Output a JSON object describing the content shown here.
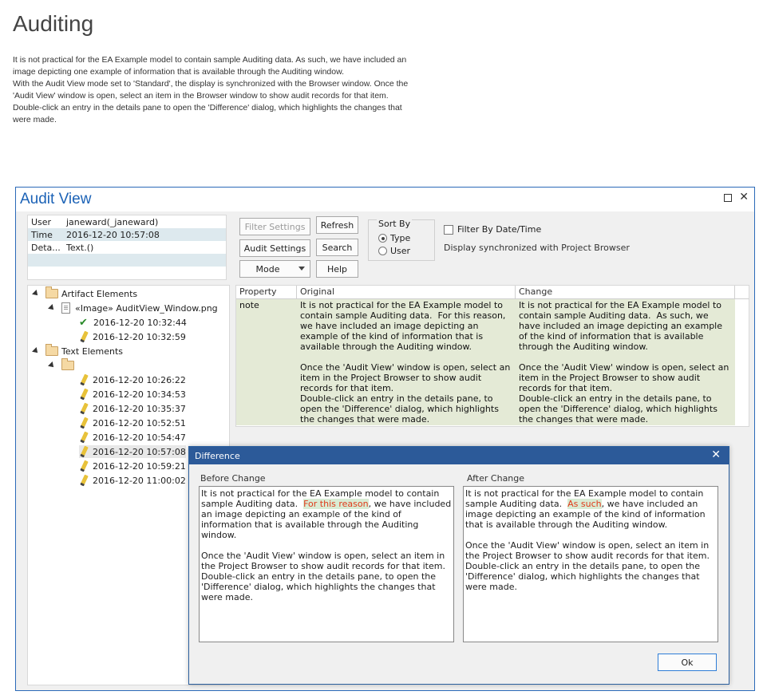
{
  "page": {
    "title": "Auditing",
    "intro": [
      "It is not practical for the EA Example model to contain sample Auditing data.  As such, we have included an image depicting one example of information that is available through the Auditing window.",
      "With the Audit View mode set to 'Standard', the display is synchronized with the Browser window.  Once the 'Audit View' window is open, select an item in the Browser window to show audit records for that item.  Double-click an entry in the details pane to open the 'Difference' dialog, which highlights the changes that were made."
    ]
  },
  "audit_view": {
    "title": "Audit View",
    "properties": [
      {
        "key": "User",
        "value": "janeward(_janeward)"
      },
      {
        "key": "Time",
        "value": "2016-12-20 10:57:08"
      },
      {
        "key": "Deta...",
        "value": "Text.()"
      }
    ],
    "buttons": {
      "filter_settings": "Filter Settings",
      "refresh": "Refresh",
      "audit_settings": "Audit Settings",
      "search": "Search",
      "mode": "Mode",
      "help": "Help"
    },
    "sort_by": {
      "label": "Sort By",
      "options": [
        "Type",
        "User"
      ],
      "selected": "Type"
    },
    "filter_by_date": {
      "label": "Filter By Date/Time",
      "checked": false
    },
    "sync_text": "Display synchronized with Project Browser",
    "tree": {
      "artifact_elements": "Artifact Elements",
      "image_item": "«Image» AuditView_Window.png",
      "artifact_records": [
        "2016-12-20 10:32:44",
        "2016-12-20 10:32:59"
      ],
      "text_elements": "Text Elements",
      "text_records": [
        "2016-12-20 10:26:22",
        "2016-12-20 10:34:53",
        "2016-12-20 10:35:37",
        "2016-12-20 10:52:51",
        "2016-12-20 10:54:47",
        "2016-12-20 10:57:08",
        "2016-12-20 10:59:21",
        "2016-12-20 11:00:02"
      ],
      "selected": "2016-12-20 10:57:08"
    },
    "grid": {
      "headers": [
        "Property",
        "Original",
        "Change"
      ],
      "row": {
        "property": "note",
        "original": "It is not practical for the EA Example model to contain sample Auditing data.  For this reason, we have included an image depicting an example of the kind of information that is available through the Auditing window.\n\nOnce the 'Audit View' window is open, select an item in the Project Browser to show audit records for that item.\nDouble-click an entry in the details pane, to open the 'Difference' dialog, which highlights the changes that were made.",
        "change": "It is not practical for the EA Example model to contain sample Auditing data.  As such, we have included an image depicting an example of the kind of information that is available through the Auditing window.\n\nOnce the 'Audit View' window is open, select an item in the Project Browser to show audit records for that item.\nDouble-click an entry in the details pane, to open the 'Difference' dialog, which highlights the changes that were made."
      }
    }
  },
  "difference": {
    "title": "Difference",
    "before_label": "Before Change",
    "after_label": "After Change",
    "before": {
      "pre": "It is not practical for the EA Example model to contain sample Auditing data.  ",
      "highlight": "For this reason",
      "post": ", we have included an image depicting an example of the kind of information that is available through the Auditing window.\n\nOnce the 'Audit View' window is open, select an item in the Project Browser to show audit records for that item.\nDouble-click an entry in the details pane, to open the 'Difference' dialog, which highlights the changes that were made."
    },
    "after": {
      "pre": "It is not practical for the EA Example model to contain sample Auditing data.  ",
      "highlight": "As such",
      "post": ", we have included an image depicting an example of the kind of information that is available through the Auditing window.\n\nOnce the 'Audit View' window is open, select an item in the Project Browser to show audit records for that item.\nDouble-click an entry in the details pane, to open the 'Difference' dialog, which highlights the changes that were made."
    },
    "ok_label": "Ok"
  }
}
